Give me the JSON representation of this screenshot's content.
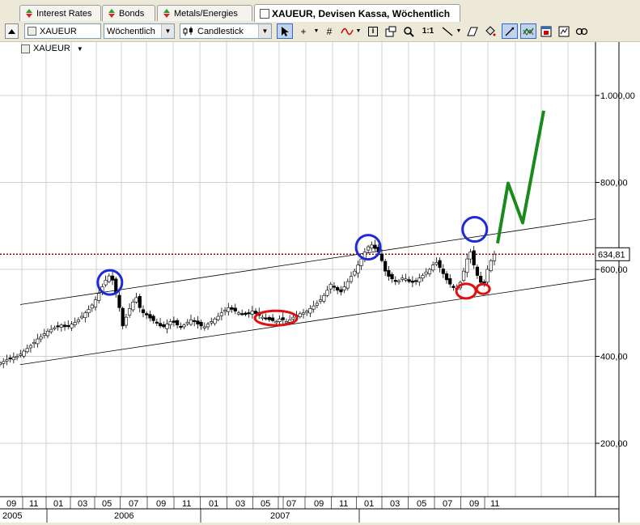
{
  "tabs": [
    {
      "label": "Interest Rates",
      "icon": "up-down-triangle-icon"
    },
    {
      "label": "Bonds",
      "icon": "up-down-triangle-icon"
    },
    {
      "label": "Metals/Energies",
      "icon": "up-down-triangle-icon"
    },
    {
      "label": "XAUEUR, Devisen Kassa, Wöchentlich",
      "icon": "chart-window-icon",
      "active": true
    }
  ],
  "toolbar": {
    "symbol_value": "XAUEUR",
    "period_value": "Wöchentlich",
    "chart_type_value": "Candlestick",
    "ratio_label": "1:1"
  },
  "legend": {
    "symbol": "XAUEUR"
  },
  "chart_data": {
    "type": "candlestick",
    "symbol": "XAUEUR",
    "period": "weekly",
    "y_ticks": [
      "1.000,00",
      "800,00",
      "600,00",
      "400,00",
      "200,00"
    ],
    "y_tick_values": [
      1000,
      800,
      600,
      400,
      200
    ],
    "ylim": [
      80,
      1110
    ],
    "current_price_label": "634,81",
    "current_price": 634.81,
    "x_month_labels": [
      "09",
      "11",
      "01",
      "03",
      "05",
      "07",
      "09",
      "11",
      "01",
      "03",
      "05",
      "07",
      "09",
      "11",
      "01",
      "03",
      "05",
      "07",
      "09",
      "11"
    ],
    "x_year_labels": [
      "2005",
      "2006",
      "2007"
    ],
    "approx_close_series": [
      385,
      388,
      392,
      395,
      398,
      400,
      405,
      412,
      418,
      425,
      432,
      440,
      445,
      452,
      458,
      462,
      466,
      470,
      472,
      468,
      470,
      474,
      478,
      484,
      492,
      500,
      508,
      518,
      530,
      545,
      560,
      575,
      585,
      575,
      545,
      512,
      470,
      490,
      510,
      525,
      535,
      512,
      500,
      495,
      488,
      482,
      476,
      470,
      468,
      474,
      480,
      478,
      472,
      468,
      472,
      478,
      484,
      480,
      474,
      470,
      468,
      474,
      480,
      486,
      492,
      500,
      506,
      512,
      508,
      504,
      500,
      498,
      496,
      500,
      504,
      498,
      494,
      490,
      488,
      484,
      482,
      480,
      486,
      484,
      480,
      484,
      490,
      494,
      498,
      500,
      504,
      510,
      516,
      522,
      530,
      540,
      552,
      566,
      560,
      552,
      548,
      560,
      572,
      584,
      596,
      610,
      624,
      640,
      652,
      656,
      648,
      640,
      620,
      596,
      584,
      578,
      572,
      574,
      580,
      578,
      572,
      570,
      574,
      580,
      586,
      594,
      600,
      610,
      616,
      604,
      590,
      576,
      566,
      558,
      556,
      570,
      596,
      624,
      640,
      610,
      586,
      570,
      566,
      600,
      620,
      634.81
    ],
    "channel": {
      "lower_start": 381,
      "lower_end": 578,
      "upper_start": 519,
      "upper_end": 716
    },
    "resistance_level": 634.81,
    "annotations": [
      {
        "type": "circle",
        "color": "#1e2ad8",
        "label": "peak 2006"
      },
      {
        "type": "circle",
        "color": "#1e2ad8",
        "label": "peak 2008 early"
      },
      {
        "type": "circle",
        "color": "#1e2ad8",
        "label": "peak 2008 late"
      },
      {
        "type": "ellipse",
        "color": "#e01010",
        "label": "consolidation 2007"
      },
      {
        "type": "ellipse",
        "color": "#e01010",
        "label": "low 1"
      },
      {
        "type": "ellipse",
        "color": "#e01010",
        "label": "low 2"
      },
      {
        "type": "polyline",
        "color": "#1a8a1a",
        "label": "projected path"
      }
    ],
    "colors": {
      "up": "#ffffff",
      "down": "#000000",
      "grid": "#d0d0d0",
      "resistance": "#9b0000"
    }
  }
}
